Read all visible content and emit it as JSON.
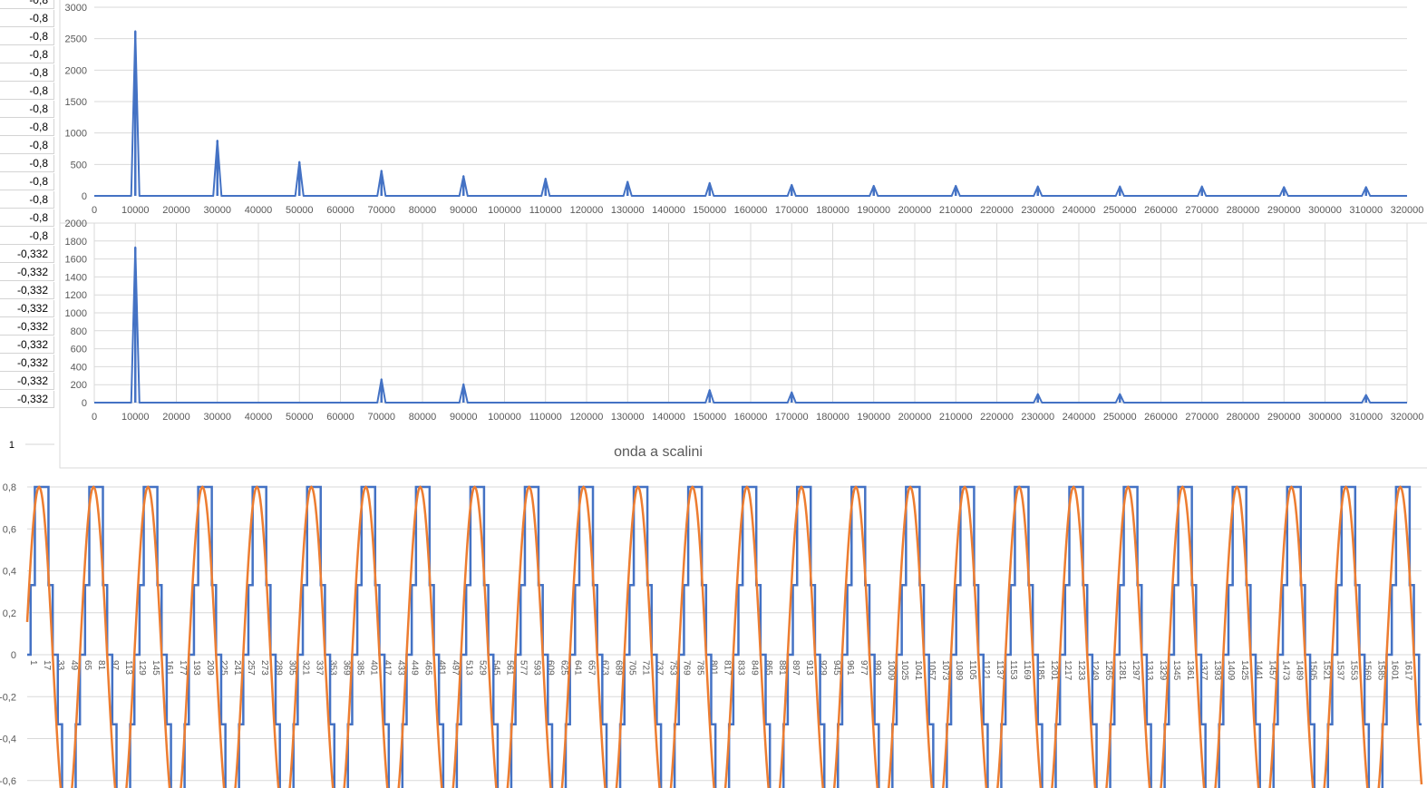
{
  "sheet": {
    "cells": [
      "-0,8",
      "-0,8",
      "-0,8",
      "-0,8",
      "-0,8",
      "-0,8",
      "-0,8",
      "-0,8",
      "-0,8",
      "-0,8",
      "-0,8",
      "-0,8",
      "-0,8",
      "-0,8",
      "-0,332",
      "-0,332",
      "-0,332",
      "-0,332",
      "-0,332",
      "-0,332",
      "-0,332",
      "-0,332",
      "-0,332"
    ],
    "row_value_1": "1"
  },
  "chart_data": [
    {
      "type": "line",
      "title": "",
      "xlim": [
        0,
        320000
      ],
      "ylim": [
        0,
        3000
      ],
      "y_ticks": [
        "0",
        "500",
        "1000",
        "1500",
        "2000",
        "2500",
        "3000"
      ],
      "x_ticks": [
        "0",
        "10000",
        "20000",
        "30000",
        "40000",
        "50000",
        "60000",
        "70000",
        "80000",
        "90000",
        "100000",
        "110000",
        "120000",
        "130000",
        "140000",
        "150000",
        "160000",
        "170000",
        "180000",
        "190000",
        "200000",
        "210000",
        "220000",
        "230000",
        "240000",
        "250000",
        "260000",
        "270000",
        "280000",
        "290000",
        "300000",
        "310000",
        "320000"
      ],
      "series": [
        {
          "color": "#4472c4",
          "peaks": [
            {
              "x": 10000,
              "y": 2620
            },
            {
              "x": 30000,
              "y": 880
            },
            {
              "x": 50000,
              "y": 540
            },
            {
              "x": 70000,
              "y": 400
            },
            {
              "x": 90000,
              "y": 315
            },
            {
              "x": 110000,
              "y": 275
            },
            {
              "x": 130000,
              "y": 225
            },
            {
              "x": 150000,
              "y": 205
            },
            {
              "x": 170000,
              "y": 175
            },
            {
              "x": 190000,
              "y": 160
            },
            {
              "x": 210000,
              "y": 160
            },
            {
              "x": 230000,
              "y": 150
            },
            {
              "x": 250000,
              "y": 150
            },
            {
              "x": 270000,
              "y": 150
            },
            {
              "x": 290000,
              "y": 140
            },
            {
              "x": 310000,
              "y": 140
            }
          ]
        }
      ]
    },
    {
      "type": "line",
      "title": "",
      "xlim": [
        0,
        320000
      ],
      "ylim": [
        0,
        2000
      ],
      "y_ticks": [
        "0",
        "200",
        "400",
        "600",
        "800",
        "1000",
        "1200",
        "1400",
        "1600",
        "1800",
        "2000"
      ],
      "x_ticks": [
        "0",
        "10000",
        "20000",
        "30000",
        "40000",
        "50000",
        "60000",
        "70000",
        "80000",
        "90000",
        "100000",
        "110000",
        "120000",
        "130000",
        "140000",
        "150000",
        "160000",
        "170000",
        "180000",
        "190000",
        "200000",
        "210000",
        "220000",
        "230000",
        "240000",
        "250000",
        "260000",
        "270000",
        "280000",
        "290000",
        "300000",
        "310000",
        "320000"
      ],
      "series": [
        {
          "color": "#4472c4",
          "peaks": [
            {
              "x": 10000,
              "y": 1730
            },
            {
              "x": 70000,
              "y": 260
            },
            {
              "x": 90000,
              "y": 205
            },
            {
              "x": 150000,
              "y": 140
            },
            {
              "x": 170000,
              "y": 115
            },
            {
              "x": 230000,
              "y": 95
            },
            {
              "x": 250000,
              "y": 95
            },
            {
              "x": 310000,
              "y": 85
            }
          ]
        }
      ]
    },
    {
      "type": "line",
      "title": "onda a scalini",
      "y_ticks": [
        "0,8",
        "0,6",
        "0,4",
        "0,2",
        "0",
        "-0,2",
        "-0,4",
        "-0,6"
      ],
      "y_tick_values": [
        0.8,
        0.6,
        0.4,
        0.2,
        0,
        -0.2,
        -0.4,
        -0.6
      ],
      "ylim": [
        -0.6,
        1
      ],
      "x_start": 1,
      "x_step": 16,
      "x_last": 1617,
      "period": 64,
      "series": [
        {
          "name": "",
          "color": "#4472c4",
          "kind": "staircase",
          "levels": [
            0.332,
            0.8
          ]
        },
        {
          "name": "",
          "color": "#ed7d31",
          "kind": "sine",
          "amplitude": 0.8
        }
      ]
    }
  ]
}
